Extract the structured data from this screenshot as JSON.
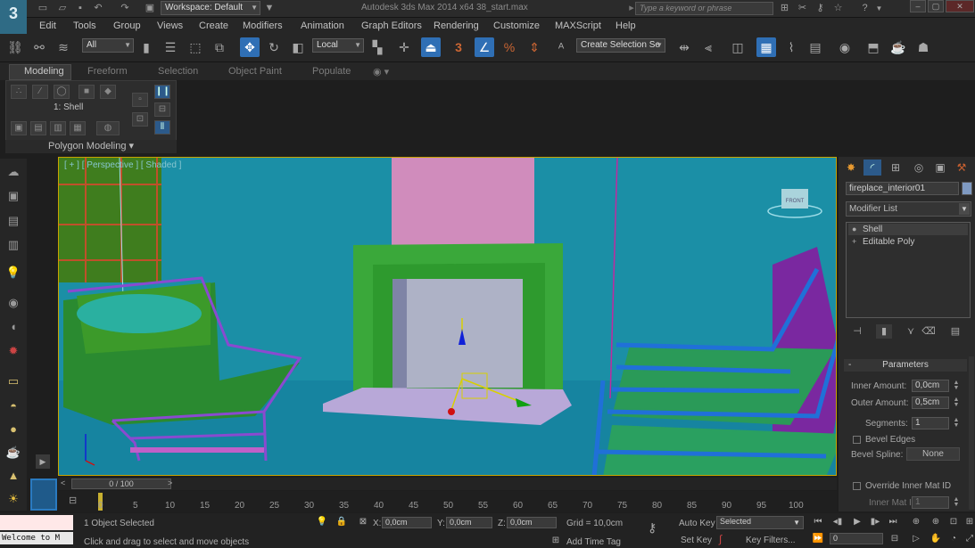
{
  "title_bar": {
    "workspace": "Workspace: Default",
    "title": "Autodesk 3ds Max  2014 x64    38_start.max",
    "search_placeholder": "Type a keyword or phrase"
  },
  "menu": [
    "Edit",
    "Tools",
    "Group",
    "Views",
    "Create",
    "Modifiers",
    "Animation",
    "Graph Editors",
    "Rendering",
    "Customize",
    "MAXScript",
    "Help"
  ],
  "toolbar": {
    "selection_filter": "All",
    "reference_coord": "Local",
    "named_selection": "Create Selection Se",
    "snap_label": "3",
    "angle_snap_label": "%"
  },
  "ribbon": {
    "tabs": [
      "Modeling",
      "Freeform",
      "Selection",
      "Object Paint",
      "Populate"
    ],
    "selected_tab": "Modeling",
    "panel_caption": "1: Shell",
    "footer": "Polygon Modeling"
  },
  "viewport": {
    "label": "[ + ] [ Perspective ] [ Shaded ]",
    "viewcube_label": "FRONT"
  },
  "command_panel": {
    "object_name": "fireplace_interior01",
    "object_color": "#7f9ac2",
    "modifier_list": "Modifier List",
    "stack": [
      {
        "label": "Shell",
        "selected": true
      },
      {
        "label": "Editable Poly",
        "selected": false
      }
    ],
    "rollout_title": "Parameters",
    "params": {
      "inner_amount_label": "Inner Amount:",
      "inner_amount": "0,0cm",
      "outer_amount_label": "Outer Amount:",
      "outer_amount": "0,5cm",
      "segments_label": "Segments:",
      "segments": "1",
      "bevel_edges": "Bevel Edges",
      "bevel_spline_label": "Bevel Spline:",
      "bevel_spline": "None",
      "override_inner": "Override Inner Mat ID",
      "inner_mat_label": "Inner Mat ID:",
      "inner_mat": "1"
    }
  },
  "timeline": {
    "frame": "0 / 100",
    "ticks": [
      "0",
      "5",
      "10",
      "15",
      "20",
      "25",
      "30",
      "35",
      "40",
      "45",
      "50",
      "55",
      "60",
      "65",
      "70",
      "75",
      "80",
      "85",
      "90",
      "95",
      "100"
    ]
  },
  "status": {
    "maxscript": "Welcome to M",
    "selected": "1 Object Selected",
    "prompt": "Click and drag to select and move objects",
    "x_label": "X:",
    "x": "0,0cm",
    "y_label": "Y:",
    "y": "0,0cm",
    "z_label": "Z:",
    "z": "0,0cm",
    "grid": "Grid = 10,0cm",
    "add_time_tag": "Add Time Tag",
    "auto_key": "Auto Key",
    "auto_key_mode": "Selected",
    "set_key": "Set Key",
    "key_filters": "Key Filters...",
    "current_frame": "0"
  }
}
